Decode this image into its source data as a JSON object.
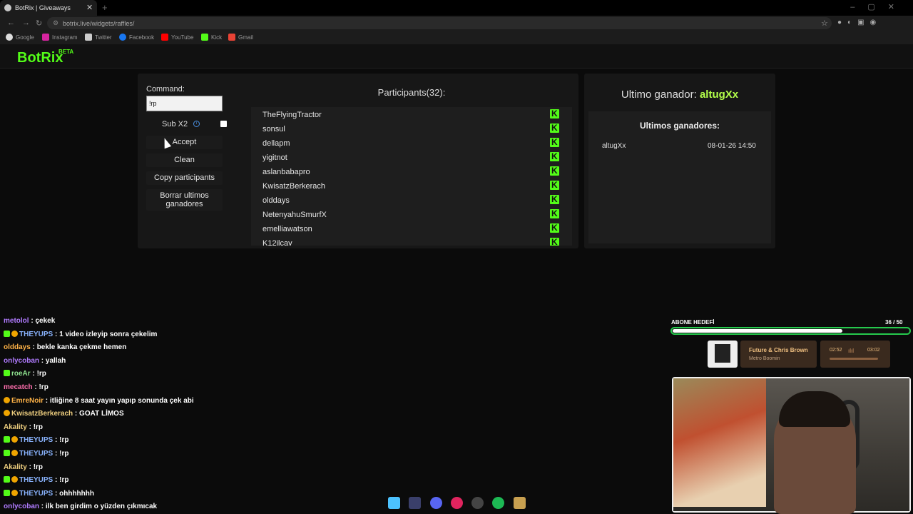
{
  "browser": {
    "tab_title": "BotRix | Giveaways",
    "url": "botrix.live/widgets/raffles/",
    "bookmarks": [
      "Google",
      "Instagram",
      "Twitter",
      "Facebook",
      "YouTube",
      "Kick",
      "Gmail"
    ]
  },
  "site": {
    "logo": "BotRix",
    "beta": "BETA"
  },
  "raffle": {
    "command_label": "Command:",
    "command_value": "!rp",
    "sub_label": "Sub X2",
    "buttons": {
      "accept": "Accept",
      "clean": "Clean",
      "copy": "Copy participants",
      "borrar": "Borrar ultimos ganadores"
    },
    "participants_title": "Participants(32):",
    "participants": [
      "TheFlyingTractor",
      "sonsul",
      "dellapm",
      "yigitnot",
      "aslanbabapro",
      "KwisatzBerkerach",
      "olddays",
      "NetenyahuSmurfX",
      "emelliawatson",
      "K12ilcay"
    ]
  },
  "winner": {
    "title_prefix": "Ultimo ganador: ",
    "name": "altugXx",
    "list_title": "Ultimos ganadores:",
    "entries": [
      {
        "name": "altugXx",
        "date": "08-01-26 14:50"
      }
    ]
  },
  "chat": [
    {
      "user": "metolol",
      "color": "#b07bff",
      "badges": [],
      "msg": "çekek"
    },
    {
      "user": "THEYUPS",
      "color": "#8ab4ff",
      "badges": [
        "kick",
        "gold"
      ],
      "msg": "1 video izleyip sonra çekelim"
    },
    {
      "user": "olddays",
      "color": "#ffb347",
      "badges": [],
      "msg": "bekle kanka çekme hemen"
    },
    {
      "user": "onlycoban",
      "color": "#b07bff",
      "badges": [],
      "msg": "yallah"
    },
    {
      "user": "roeAr",
      "color": "#8fe38f",
      "badges": [
        "kick"
      ],
      "msg": "!rp"
    },
    {
      "user": "mecatch",
      "color": "#ff6fae",
      "badges": [],
      "msg": "!rp"
    },
    {
      "user": "EmreNoir",
      "color": "#ffb347",
      "badges": [
        "gold"
      ],
      "msg": "itliğine 8 saat yayın yapıp sonunda çek abi"
    },
    {
      "user": "KwisatzBerkerach",
      "color": "#f0d080",
      "badges": [
        "gold"
      ],
      "msg": "GOAT LİMOS"
    },
    {
      "user": "Akality",
      "color": "#f0d080",
      "badges": [],
      "msg": "!rp"
    },
    {
      "user": "THEYUPS",
      "color": "#8ab4ff",
      "badges": [
        "kick",
        "gold"
      ],
      "msg": "!rp"
    },
    {
      "user": "THEYUPS",
      "color": "#8ab4ff",
      "badges": [
        "kick",
        "gold"
      ],
      "msg": "!rp"
    },
    {
      "user": "Akality",
      "color": "#f0d080",
      "badges": [],
      "msg": "!rp"
    },
    {
      "user": "THEYUPS",
      "color": "#8ab4ff",
      "badges": [
        "kick",
        "gold"
      ],
      "msg": "!rp"
    },
    {
      "user": "THEYUPS",
      "color": "#8ab4ff",
      "badges": [
        "kick",
        "gold"
      ],
      "msg": "ohhhhhhh"
    },
    {
      "user": "onlycoban",
      "color": "#b07bff",
      "badges": [],
      "msg": "ilk ben girdim o yüzden çıkmıcak"
    }
  ],
  "overlay": {
    "goal_label": "ABONE HEDEFİ",
    "goal_count": "36  / 50",
    "goal_progress": 0.72,
    "song_title": "Future & Chris Brown",
    "song_artist": "Metro Boomin",
    "time_current": "02:52",
    "time_total": "03:02"
  },
  "colors": {
    "accent": "#53fc18",
    "winner": "#b3ff4a"
  }
}
